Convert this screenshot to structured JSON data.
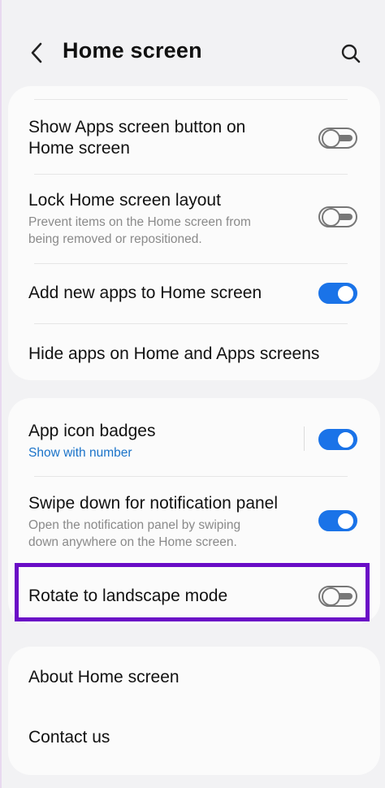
{
  "header": {
    "title": "Home screen",
    "back_icon": "chevron-left-icon",
    "search_icon": "search-icon"
  },
  "group1": {
    "items": [
      {
        "title_line1": "Show Apps screen button on",
        "title_line2": "Home screen",
        "toggle": "off"
      },
      {
        "title": "Lock Home screen layout",
        "sub_line1": "Prevent items on the Home screen from",
        "sub_line2": "being removed or repositioned.",
        "toggle": "off"
      },
      {
        "title": "Add new apps to Home screen",
        "toggle": "on"
      },
      {
        "title": "Hide apps on Home and Apps screens"
      }
    ]
  },
  "group2": {
    "items": [
      {
        "title": "App icon badges",
        "sub": "Show with number",
        "toggle": "on"
      },
      {
        "title": "Swipe down for notification panel",
        "sub_line1": "Open the notification panel by swiping",
        "sub_line2": "down anywhere on the Home screen.",
        "toggle": "on"
      },
      {
        "title": "Rotate to landscape mode",
        "toggle": "off",
        "highlighted": true
      }
    ]
  },
  "group3": {
    "items": [
      {
        "title": "About Home screen"
      },
      {
        "title": "Contact us"
      }
    ]
  },
  "colors": {
    "accent": "#1a73e8",
    "link": "#1a73c9",
    "highlight": "#6a0dc6",
    "background": "#f2f2f4",
    "card": "#fbfbfb"
  }
}
